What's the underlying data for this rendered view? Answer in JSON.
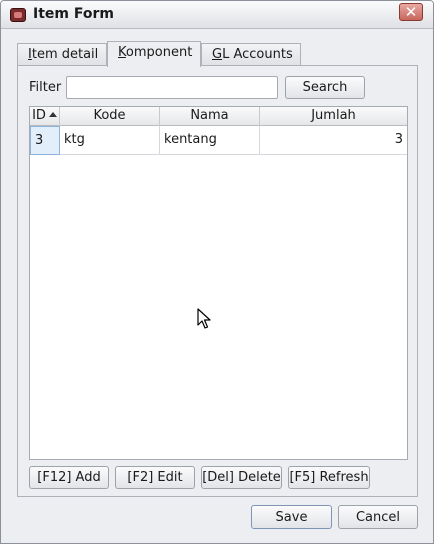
{
  "window": {
    "title": "Item Form",
    "close_label": "✕"
  },
  "tabs": [
    {
      "prefix": "",
      "mnemonic": "I",
      "rest": "tem detail",
      "active": false
    },
    {
      "prefix": "",
      "mnemonic": "K",
      "rest": "omponent",
      "active": true
    },
    {
      "prefix": "",
      "mnemonic": "G",
      "rest": "L Accounts",
      "active": false
    }
  ],
  "filter": {
    "label": "Filter",
    "value": "",
    "search_label": "Search"
  },
  "table": {
    "columns": [
      "ID",
      "Kode",
      "Nama",
      "Jumlah"
    ],
    "sort_column": "ID",
    "rows": [
      {
        "id": "3",
        "kode": "ktg",
        "nama": "kentang",
        "jumlah": "3"
      }
    ]
  },
  "actions": {
    "add": "[F12] Add",
    "edit": "[F2] Edit",
    "delete": "[Del] Delete",
    "refresh": "[F5] Refresh"
  },
  "dialog": {
    "save": "Save",
    "cancel": "Cancel"
  },
  "colors": {
    "selection": "#e3eefb",
    "close_button": "#c8665d"
  },
  "icons": [
    "app-icon",
    "close-icon",
    "sort-ascending-icon",
    "mouse-pointer-icon"
  ]
}
